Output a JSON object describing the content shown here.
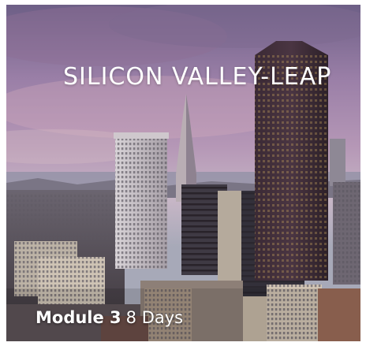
{
  "course_card": {
    "title": "SILICON VALLEY-LEAP",
    "module_label": "Module 3",
    "duration": "8 Days",
    "image_subject": "San Francisco skyline at dusk"
  }
}
